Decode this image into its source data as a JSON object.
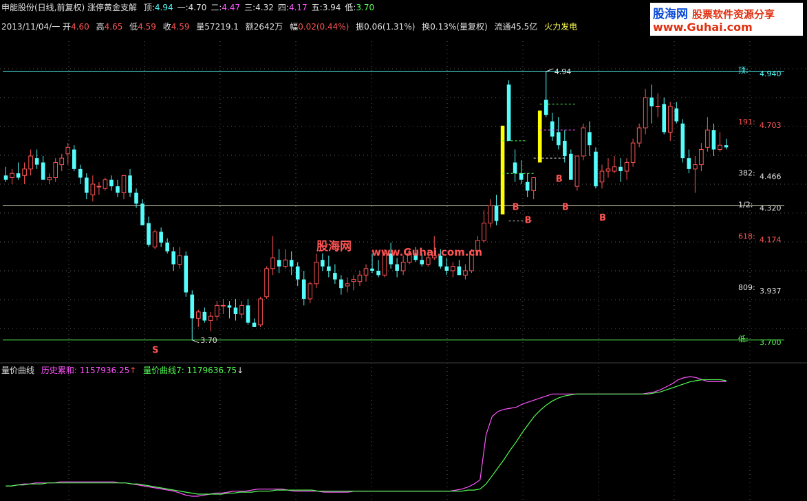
{
  "header": {
    "title": "申能股份(日线,前复权) 涨停黄金支解",
    "levels": [
      {
        "label": "顶:",
        "value": "4.94",
        "color": "#54fcfc"
      },
      {
        "label": "一:",
        "value": "4.70",
        "color": "#e0e0e0"
      },
      {
        "label": "二:",
        "value": "4.47",
        "color": "#ff54ff"
      },
      {
        "label": "三:",
        "value": "4.32",
        "color": "#e0e0e0"
      },
      {
        "label": "四:",
        "value": "4.17",
        "color": "#ff54ff"
      },
      {
        "label": "五:",
        "value": "3.94",
        "color": "#e0e0e0"
      },
      {
        "label": "低:",
        "value": "3.70",
        "color": "#54fc54"
      }
    ],
    "date": "2013/11/04/一",
    "open_label": "开",
    "open": "4.60",
    "high_label": "高",
    "high": "4.65",
    "low_label": "低",
    "low": "4.59",
    "close_label": "收",
    "close": "4.59",
    "volume": "量57219.1",
    "amount": "额2642万",
    "change_label": "幅",
    "change": "0.02(0.44%)",
    "amplitude": "振0.06(1.31%)",
    "turnover": "换0.13%(量复权)",
    "float_cap": "流通45.5亿",
    "sector": "火力发电"
  },
  "logo": {
    "brand": "股海网",
    "tagline": "股票软件资源分享",
    "url": "www.Guhai.com"
  },
  "watermark": {
    "brand": "股海网",
    "url": "www.Guhai.com.cn"
  },
  "chart_data": {
    "type": "candlestick",
    "ylim": [
      3.62,
      5.08
    ],
    "up_color": "#ff5454",
    "down_color": "#54fcfc",
    "ohlc": [
      [
        4.46,
        4.5,
        4.43,
        4.44
      ],
      [
        4.45,
        4.49,
        4.42,
        4.47
      ],
      [
        4.47,
        4.52,
        4.44,
        4.45
      ],
      [
        4.46,
        4.52,
        4.42,
        4.49
      ],
      [
        4.49,
        4.58,
        4.46,
        4.55
      ],
      [
        4.54,
        4.58,
        4.49,
        4.51
      ],
      [
        4.52,
        4.55,
        4.44,
        4.44
      ],
      [
        4.44,
        4.47,
        4.42,
        4.45
      ],
      [
        4.45,
        4.54,
        4.43,
        4.52
      ],
      [
        4.51,
        4.56,
        4.48,
        4.54
      ],
      [
        4.56,
        4.61,
        4.51,
        4.59
      ],
      [
        4.58,
        4.6,
        4.48,
        4.49
      ],
      [
        4.49,
        4.51,
        4.42,
        4.45
      ],
      [
        4.45,
        4.47,
        4.35,
        4.38
      ],
      [
        4.37,
        4.46,
        4.34,
        4.42
      ],
      [
        4.41,
        4.43,
        4.37,
        4.41
      ],
      [
        4.4,
        4.45,
        4.39,
        4.44
      ],
      [
        4.44,
        4.46,
        4.39,
        4.41
      ],
      [
        4.41,
        4.44,
        4.36,
        4.38
      ],
      [
        4.38,
        4.46,
        4.35,
        4.46
      ],
      [
        4.46,
        4.49,
        4.36,
        4.38
      ],
      [
        4.38,
        4.4,
        4.31,
        4.33
      ],
      [
        4.33,
        4.35,
        4.23,
        4.23
      ],
      [
        4.24,
        4.27,
        4.13,
        4.14
      ],
      [
        4.13,
        4.21,
        4.12,
        4.2
      ],
      [
        4.2,
        4.22,
        4.13,
        4.15
      ],
      [
        4.15,
        4.17,
        4.1,
        4.11
      ],
      [
        4.11,
        4.13,
        4.02,
        4.05
      ],
      [
        4.05,
        4.13,
        4.03,
        4.09
      ],
      [
        4.09,
        4.11,
        3.9,
        3.92
      ],
      [
        3.91,
        3.93,
        3.7,
        3.8
      ],
      [
        3.8,
        3.84,
        3.76,
        3.83
      ],
      [
        3.83,
        3.85,
        3.78,
        3.79
      ],
      [
        3.79,
        3.83,
        3.74,
        3.81
      ],
      [
        3.81,
        3.88,
        3.79,
        3.86
      ],
      [
        3.86,
        3.89,
        3.82,
        3.86
      ],
      [
        3.86,
        3.88,
        3.8,
        3.85
      ],
      [
        3.85,
        3.89,
        3.79,
        3.82
      ],
      [
        3.82,
        3.88,
        3.8,
        3.86
      ],
      [
        3.86,
        3.89,
        3.77,
        3.78
      ],
      [
        3.78,
        3.8,
        3.76,
        3.76
      ],
      [
        3.77,
        3.9,
        3.76,
        3.89
      ],
      [
        3.9,
        4.04,
        3.89,
        4.03
      ],
      [
        4.03,
        4.18,
        4.0,
        4.08
      ],
      [
        4.07,
        4.12,
        4.01,
        4.04
      ],
      [
        4.04,
        4.12,
        4.03,
        4.07
      ],
      [
        4.07,
        4.11,
        4.0,
        4.04
      ],
      [
        4.04,
        4.06,
        3.95,
        3.98
      ],
      [
        3.98,
        4.02,
        3.86,
        3.89
      ],
      [
        3.89,
        3.97,
        3.87,
        3.96
      ],
      [
        3.96,
        4.1,
        3.94,
        4.06
      ],
      [
        4.07,
        4.1,
        4.02,
        4.04
      ],
      [
        4.04,
        4.09,
        3.99,
        4.02
      ],
      [
        4.01,
        4.05,
        3.96,
        3.98
      ],
      [
        3.98,
        4.0,
        3.91,
        3.94
      ],
      [
        3.95,
        3.99,
        3.92,
        3.96
      ],
      [
        3.97,
        4.0,
        3.93,
        3.98
      ],
      [
        3.97,
        4.02,
        3.95,
        4.0
      ],
      [
        4.0,
        4.05,
        3.97,
        4.03
      ],
      [
        4.03,
        4.1,
        4.01,
        4.02
      ],
      [
        4.02,
        4.07,
        3.99,
        4.0
      ],
      [
        4.0,
        4.12,
        3.99,
        4.1
      ],
      [
        4.1,
        4.15,
        4.03,
        4.05
      ],
      [
        4.05,
        4.08,
        3.99,
        4.02
      ],
      [
        4.02,
        4.09,
        4.0,
        4.06
      ],
      [
        4.06,
        4.12,
        4.05,
        4.1
      ],
      [
        4.1,
        4.13,
        4.06,
        4.07
      ],
      [
        4.07,
        4.1,
        4.04,
        4.05
      ],
      [
        4.05,
        4.11,
        4.04,
        4.08
      ],
      [
        4.08,
        4.18,
        4.07,
        4.09
      ],
      [
        4.09,
        4.12,
        4.03,
        4.04
      ],
      [
        4.04,
        4.08,
        4.0,
        4.02
      ],
      [
        4.02,
        4.06,
        3.99,
        4.04
      ],
      [
        4.04,
        4.07,
        4.0,
        4.0
      ],
      [
        4.0,
        4.05,
        3.98,
        4.02
      ],
      [
        4.02,
        4.12,
        4.01,
        4.11
      ],
      [
        4.11,
        4.18,
        4.09,
        4.16
      ],
      [
        4.16,
        4.3,
        4.15,
        4.24
      ],
      [
        4.24,
        4.35,
        4.22,
        4.32
      ],
      [
        4.32,
        4.37,
        4.23,
        4.25
      ],
      [
        4.28,
        4.69,
        4.28,
        4.69
      ],
      [
        4.88,
        4.9,
        4.62,
        4.62
      ],
      [
        4.52,
        4.58,
        4.43,
        4.47
      ],
      [
        4.47,
        4.53,
        4.42,
        4.44
      ],
      [
        4.43,
        4.47,
        4.36,
        4.39
      ],
      [
        4.39,
        4.45,
        4.35,
        4.45
      ],
      [
        4.52,
        4.76,
        4.52,
        4.76
      ],
      [
        4.81,
        4.94,
        4.73,
        4.74
      ],
      [
        4.71,
        4.75,
        4.62,
        4.64
      ],
      [
        4.66,
        4.73,
        4.58,
        4.6
      ],
      [
        4.62,
        4.67,
        4.52,
        4.55
      ],
      [
        4.56,
        4.58,
        4.44,
        4.44
      ],
      [
        4.41,
        4.55,
        4.39,
        4.55
      ],
      [
        4.55,
        4.7,
        4.53,
        4.68
      ],
      [
        4.66,
        4.71,
        4.55,
        4.6
      ],
      [
        4.57,
        4.59,
        4.4,
        4.41
      ],
      [
        4.43,
        4.51,
        4.4,
        4.48
      ],
      [
        4.48,
        4.54,
        4.45,
        4.49
      ],
      [
        4.48,
        4.55,
        4.47,
        4.5
      ],
      [
        4.5,
        4.54,
        4.43,
        4.48
      ],
      [
        4.48,
        4.54,
        4.44,
        4.52
      ],
      [
        4.52,
        4.63,
        4.5,
        4.61
      ],
      [
        4.61,
        4.7,
        4.59,
        4.68
      ],
      [
        4.68,
        4.86,
        4.65,
        4.82
      ],
      [
        4.82,
        4.88,
        4.7,
        4.78
      ],
      [
        4.78,
        4.84,
        4.73,
        4.78
      ],
      [
        4.79,
        4.82,
        4.65,
        4.66
      ],
      [
        4.66,
        4.8,
        4.62,
        4.78
      ],
      [
        4.77,
        4.8,
        4.7,
        4.71
      ],
      [
        4.7,
        4.72,
        4.52,
        4.54
      ],
      [
        4.54,
        4.58,
        4.47,
        4.49
      ],
      [
        4.49,
        4.55,
        4.38,
        4.51
      ],
      [
        4.51,
        4.61,
        4.48,
        4.58
      ],
      [
        4.59,
        4.73,
        4.57,
        4.67
      ],
      [
        4.67,
        4.7,
        4.55,
        4.58
      ],
      [
        4.58,
        4.66,
        4.57,
        4.6
      ],
      [
        4.6,
        4.63,
        4.58,
        4.59
      ]
    ],
    "limit_up_bars": [
      80,
      86
    ],
    "gold_levels": [
      {
        "label": "顶:",
        "value": 4.94,
        "printed": "4.940",
        "color": "#54fcfc"
      },
      {
        "label": "191:",
        "value": 4.703,
        "printed": "4.703",
        "color": "#ff5454"
      },
      {
        "label": "382:",
        "value": 4.466,
        "printed": "4.466",
        "color": "#e0e0e0"
      },
      {
        "label": "1/2:",
        "value": 4.32,
        "printed": "4.320",
        "color": "#e0e0e0"
      },
      {
        "label": "618:",
        "value": 4.174,
        "printed": "4.174",
        "color": "#ff5454"
      },
      {
        "label": "809:",
        "value": 3.937,
        "printed": "3.937",
        "color": "#e0e0e0"
      },
      {
        "label": "低:",
        "value": 3.7,
        "printed": "3.700",
        "color": "#54fc54"
      }
    ],
    "top_line": 4.94,
    "mid_line": 4.32,
    "bottom_line": 3.7,
    "annotations": [
      {
        "text": "4.94",
        "bar": 87,
        "value": 4.94,
        "type": "high"
      },
      {
        "text": "3.70",
        "bar": 30,
        "value": 3.7,
        "type": "low"
      }
    ],
    "signals": [
      {
        "text": "S",
        "bar": 24,
        "value": 3.66,
        "color": "#ff5454"
      },
      {
        "text": "B",
        "bar": 82,
        "value": 4.32,
        "color": "#ff5454"
      },
      {
        "text": "B",
        "bar": 84,
        "value": 4.26,
        "color": "#ff5454"
      },
      {
        "text": "B",
        "bar": 89,
        "value": 4.45,
        "color": "#ff5454"
      },
      {
        "text": "B",
        "bar": 90,
        "value": 4.32,
        "color": "#ff5454"
      },
      {
        "text": "B",
        "bar": 96,
        "value": 4.27,
        "color": "#ff5454"
      }
    ],
    "dashed_refs": [
      {
        "from": 80,
        "to": 85,
        "value": 4.47,
        "color": "#54fc54"
      },
      {
        "from": 81,
        "to": 85,
        "value": 4.25,
        "color": "#e0e0e0"
      },
      {
        "from": 80,
        "to": 84,
        "value": 4.62,
        "color": "#54fc54"
      },
      {
        "from": 86,
        "to": 92,
        "value": 4.79,
        "color": "#54fc54"
      },
      {
        "from": 86,
        "to": 92,
        "value": 4.67,
        "color": "#ff54ff"
      },
      {
        "from": 85,
        "to": 90,
        "value": 4.54,
        "color": "#e0e0e0"
      }
    ],
    "indicator": {
      "title": "量价曲线",
      "series": [
        {
          "name": "历史累和",
          "value": "1157936.25",
          "arrow": "↑",
          "color": "#ff54ff",
          "values": [
            0.1,
            0.1,
            0.11,
            0.12,
            0.12,
            0.13,
            0.13,
            0.13,
            0.13,
            0.14,
            0.14,
            0.14,
            0.14,
            0.14,
            0.14,
            0.14,
            0.14,
            0.14,
            0.14,
            0.13,
            0.13,
            0.12,
            0.11,
            0.1,
            0.09,
            0.08,
            0.07,
            0.06,
            0.05,
            0.03,
            0.01,
            0.0,
            0.0,
            0.01,
            0.02,
            0.03,
            0.03,
            0.04,
            0.05,
            0.05,
            0.05,
            0.06,
            0.07,
            0.07,
            0.07,
            0.07,
            0.07,
            0.06,
            0.05,
            0.05,
            0.05,
            0.05,
            0.05,
            0.04,
            0.04,
            0.04,
            0.04,
            0.04,
            0.05,
            0.05,
            0.05,
            0.05,
            0.05,
            0.05,
            0.05,
            0.05,
            0.05,
            0.05,
            0.05,
            0.05,
            0.05,
            0.05,
            0.05,
            0.05,
            0.05,
            0.06,
            0.07,
            0.09,
            0.12,
            0.16,
            0.6,
            0.78,
            0.83,
            0.85,
            0.86,
            0.87,
            0.9,
            0.92,
            0.94,
            0.96,
            0.98,
            1.0,
            1.0,
            1.0,
            1.0,
            1.0,
            1.0,
            1.0,
            1.0,
            1.0,
            1.0,
            1.0,
            1.0,
            1.0,
            1.0,
            1.0,
            1.0,
            1.01,
            1.02,
            1.04,
            1.07,
            1.1,
            1.14,
            1.16,
            1.17,
            1.16,
            1.14,
            1.12,
            1.12,
            1.12,
            1.12
          ]
        },
        {
          "name": "量价曲线7",
          "value": "1179636.75",
          "arrow": "↓",
          "color": "#54fc54",
          "values": [
            0.1,
            0.1,
            0.11,
            0.11,
            0.12,
            0.12,
            0.12,
            0.13,
            0.13,
            0.13,
            0.13,
            0.13,
            0.13,
            0.13,
            0.13,
            0.13,
            0.13,
            0.13,
            0.13,
            0.13,
            0.13,
            0.12,
            0.12,
            0.11,
            0.1,
            0.09,
            0.08,
            0.07,
            0.06,
            0.05,
            0.04,
            0.03,
            0.02,
            0.02,
            0.02,
            0.02,
            0.02,
            0.03,
            0.03,
            0.04,
            0.04,
            0.04,
            0.05,
            0.05,
            0.05,
            0.06,
            0.06,
            0.06,
            0.06,
            0.06,
            0.06,
            0.06,
            0.05,
            0.05,
            0.05,
            0.05,
            0.05,
            0.05,
            0.05,
            0.05,
            0.05,
            0.05,
            0.05,
            0.05,
            0.05,
            0.05,
            0.05,
            0.05,
            0.05,
            0.05,
            0.05,
            0.05,
            0.05,
            0.05,
            0.05,
            0.05,
            0.05,
            0.06,
            0.06,
            0.07,
            0.12,
            0.2,
            0.28,
            0.36,
            0.45,
            0.53,
            0.62,
            0.7,
            0.78,
            0.84,
            0.89,
            0.93,
            0.96,
            0.98,
            0.99,
            1.0,
            1.0,
            1.0,
            1.0,
            1.0,
            1.0,
            1.0,
            1.0,
            1.0,
            1.0,
            1.0,
            1.0,
            1.0,
            1.01,
            1.02,
            1.04,
            1.06,
            1.08,
            1.1,
            1.12,
            1.13,
            1.14,
            1.14,
            1.14,
            1.14,
            1.13
          ]
        }
      ]
    }
  }
}
